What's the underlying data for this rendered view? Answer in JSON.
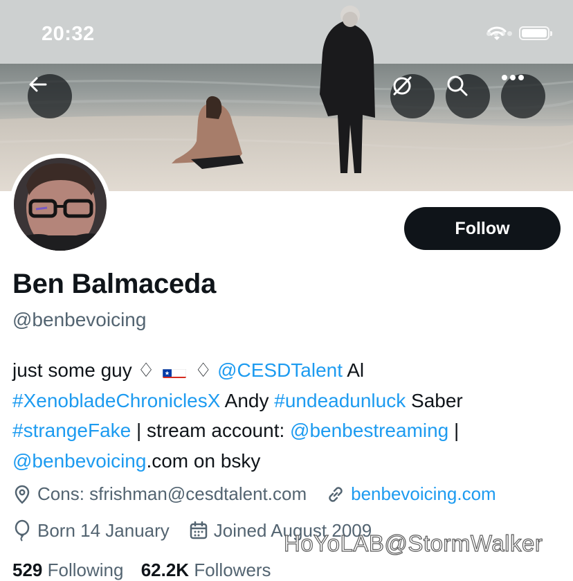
{
  "status_bar": {
    "time": "20:32"
  },
  "profile": {
    "name": "Ben Balmaceda",
    "handle": "@benbevoicing",
    "follow_label": "Follow",
    "bio": {
      "t1": "just some guy ♢ ",
      "t2": " ♢ ",
      "mention1": "@CESDTalent",
      "t3": " Al ",
      "hashtag1": "#XenobladeChroniclesX",
      "t4": " Andy ",
      "hashtag2": "#undeadunluck",
      "t5": " Saber ",
      "hashtag3": "#strangeFake",
      "t6": " | stream account: ",
      "mention2": "@benbestreaming",
      "t7": " | ",
      "mention3": "@benbevoicing",
      "t8": ".com on bsky"
    },
    "location": "Cons: sfrishman@cesdtalent.com",
    "website": "benbevoicing.com",
    "birthday": "Born 14 January",
    "joined": "Joined August 2009",
    "following_count": "529",
    "following_label": "Following",
    "followers_count": "62.2K",
    "followers_label": "Followers"
  },
  "watermark": "HoYoLAB@StormWalker",
  "icons": [
    "back-arrow-icon",
    "grok-icon",
    "search-icon",
    "more-icon",
    "location-pin-icon",
    "link-icon",
    "birthday-balloon-icon",
    "calendar-icon",
    "wifi-icon",
    "battery-icon",
    "chile-flag-icon"
  ],
  "colors": {
    "link": "#1d9bf0",
    "text": "#0f1419",
    "secondary": "#536471",
    "button": "#0f1419"
  }
}
